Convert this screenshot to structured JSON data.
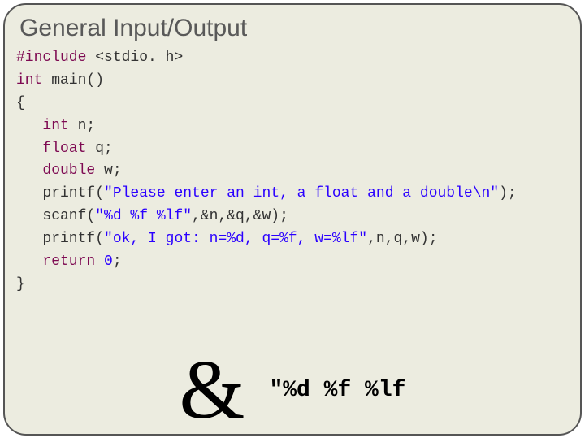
{
  "title": "General Input/Output",
  "code": {
    "l1a": "#include",
    "l1b": " <stdio. h>",
    "l2a": "int",
    "l2b": " main()",
    "l3": "{",
    "l4a": "   int",
    "l4b": " n;",
    "l5a": "   float",
    "l5b": " q;",
    "l6a": "   double",
    "l6b": " w;",
    "l7a": "   printf(",
    "l7b": "\"Please enter an int, a float and a double\\n\"",
    "l7c": ");",
    "l8a": "   scanf(",
    "l8b": "\"%d %f %lf\"",
    "l8c": ",&n,&q,&w);",
    "l9a": "   printf(",
    "l9b": "\"ok, I got: n=%d, q=%f, w=%lf\"",
    "l9c": ",n,q,w);",
    "l10a": "   return",
    "l10b": " 0",
    "l10c": ";",
    "l11": "}"
  },
  "bottom": {
    "amp": "&",
    "format": "\"%d %f %lf"
  }
}
